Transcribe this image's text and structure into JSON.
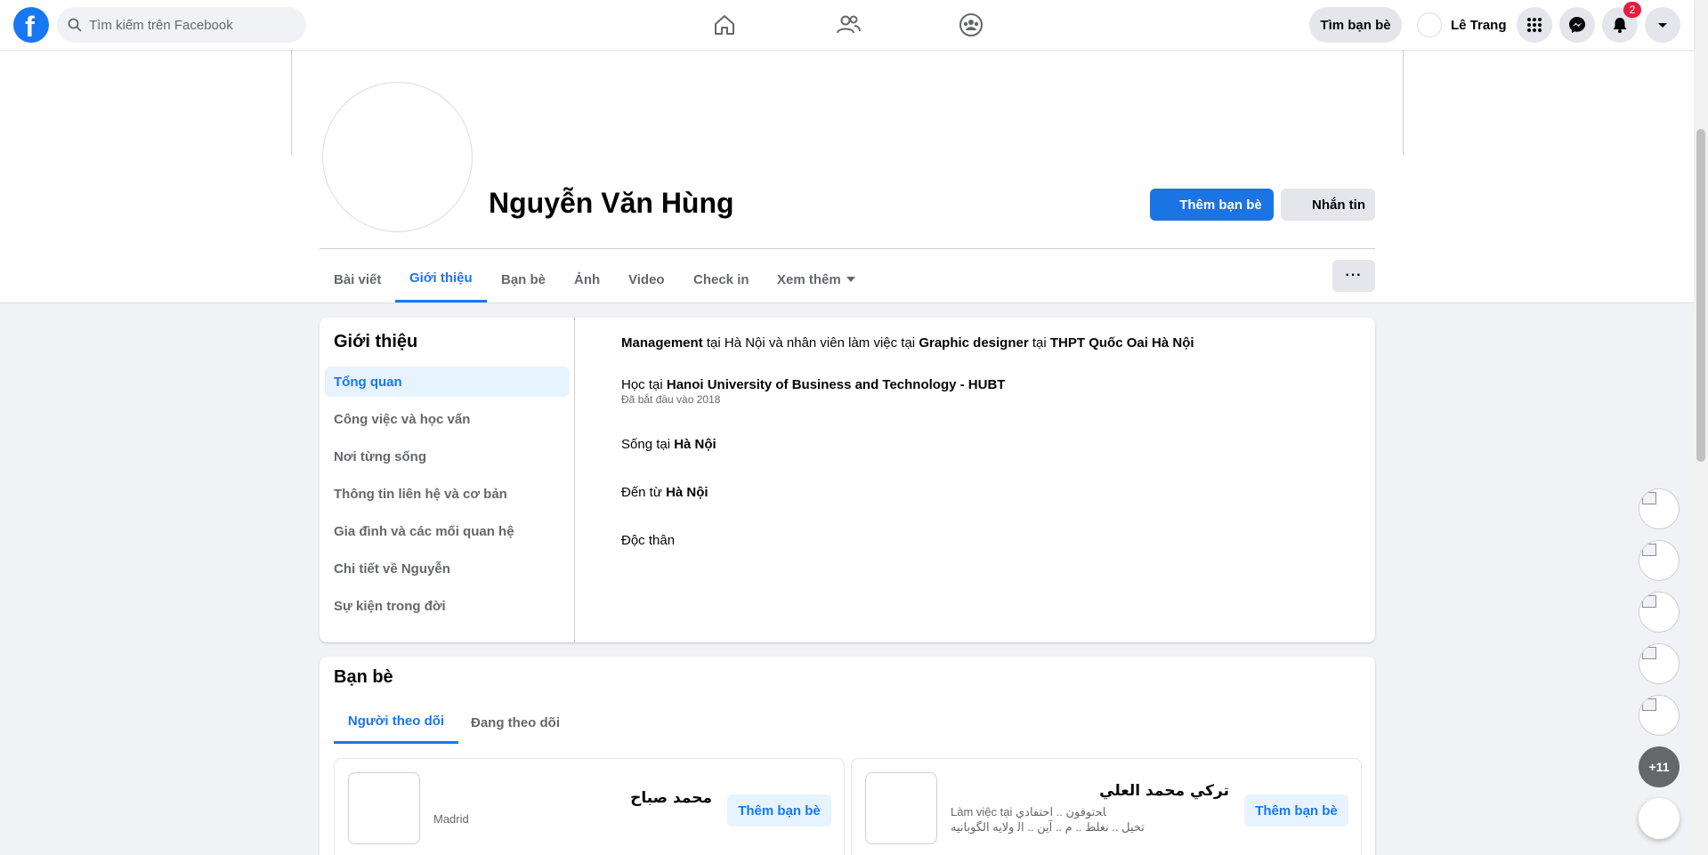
{
  "topbar": {
    "logo": "f",
    "search_placeholder": "Tìm kiếm trên Facebook",
    "find_friends": "Tìm bạn bè",
    "user_name": "Lê Trang",
    "notification_count": "2",
    "icons": [
      "home-icon",
      "friends-icon",
      "groups-icon",
      "menu-grid-icon",
      "messenger-icon",
      "bell-icon",
      "caret-down-icon"
    ]
  },
  "profile": {
    "name": "Nguyễn Văn Hùng",
    "add_friend": "Thêm bạn bè",
    "message": "Nhắn tin"
  },
  "tabs": [
    "Bài viết",
    "Giới thiệu",
    "Bạn bè",
    "Ảnh",
    "Video",
    "Check in",
    "Xem thêm"
  ],
  "more_button": "···",
  "about": {
    "title": "Giới thiệu",
    "nav": [
      "Tổng quan",
      "Công việc và học vấn",
      "Nơi từng sống",
      "Thông tin liên hệ và cơ bản",
      "Gia đình và các mối quan hệ",
      "Chi tiết về Nguyễn",
      "Sự kiện trong đời"
    ],
    "work": {
      "position": "Management",
      "t1": " tại Hà Nội và nhân viên làm việc tại ",
      "title2": "Graphic designer",
      "t2": " tại ",
      "company": "THPT Quốc Oai Hà Nội"
    },
    "education": {
      "prefix": "Học tại ",
      "school": "Hanoi University of Business and Technology - HUBT",
      "since": "Đã bắt đầu vào 2018"
    },
    "lives": {
      "prefix": "Sống tại ",
      "place": "Hà Nội"
    },
    "from": {
      "prefix": "Đến từ ",
      "place": "Hà Nội"
    },
    "relationship": "Độc thân"
  },
  "friends": {
    "title": "Bạn bè",
    "tabs": [
      "Người theo dõi",
      "Đang theo dõi"
    ],
    "cards": [
      {
        "name": "محمد صباح",
        "sub": "Madrid",
        "button": "Thêm bạn bè"
      },
      {
        "name": "تركي محمد العلي",
        "sub": "Làm việc tại ﺎﺤﺗﻮﻓﻮﻥ .. ﺍﺣﺘﻔﺎﺩﻱ",
        "sub2": "ﺗﺨﻴﻞ .. ﻧﻐﻠﻂ .. ﻡ .. ﺁﻳﻦ .. ﺍﻟ ﻭﻟﺎﻳﻪ ﺍﻟﮕﻮﺑﺎﻧﻴﻪ",
        "button": "Thêm bạn bè"
      }
    ]
  },
  "chat": {
    "more_contacts": "+11"
  }
}
